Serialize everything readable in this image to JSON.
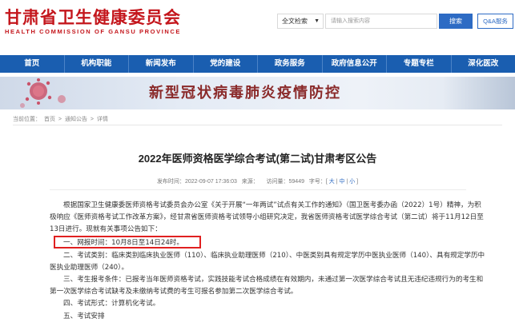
{
  "header": {
    "logo_cn": "甘肃省卫生健康委员会",
    "logo_en": "HEALTH COMMISSION OF GANSU PROVINCE",
    "search_scope": "全文检索",
    "search_placeholder": "请输入搜索内容",
    "search_button": "搜索",
    "qa_button": "Q&A服务"
  },
  "nav": {
    "items": [
      "首页",
      "机构职能",
      "新闻发布",
      "党的建设",
      "政务服务",
      "政府信息公开",
      "专题专栏",
      "深化医改"
    ]
  },
  "banner": {
    "text": "新型冠状病毒肺炎疫情防控"
  },
  "breadcrumb": {
    "prefix": "当前位置：",
    "items": [
      "首页",
      "通知公告",
      "详情"
    ],
    "separator": ">"
  },
  "article": {
    "title": "2022年医师资格医学综合考试(第二试)甘肃考区公告",
    "publish_label": "发布时间：",
    "publish_time": "2022-09-07 17:36:03",
    "source_label": "来源：",
    "visits_label": "访问量：",
    "visits": "59449",
    "font_label": "字号：",
    "font_large": "大",
    "font_medium": "中",
    "font_small": "小",
    "p1": "根据国家卫生健康委医师资格考试委员会办公室《关于开展“一年两试”试点有关工作的通知》（国卫医考委办函（2022）1号）精神，为积极响应《医师资格考试工作改革方案》，经甘肃省医师资格考试领导小组研究决定，我省医师资格考试医学综合考试（第二试）将于11月12日至13日进行。现就有关事项公告如下：",
    "item1": "一、网报时间：10月8日至14日24时。",
    "p2": "二、考试类别：临床类别临床执业医师（110）、临床执业助理医师（210）、中医类别具有规定学历中医执业医师（140）、具有规定学历中医执业助理医师（240）。",
    "p3": "三、考生报考条件：已报考当年医师资格考试，实践技能考试合格成绩在有效期内，未通过第一次医学综合考试且无违纪违规行为的考生和第一次医学综合考试缺考及未缴纳考试费的考生可报名参加第二次医学综合考试。",
    "item4": "四、考试形式：计算机化考试。",
    "item5": "五、考试安排"
  },
  "colors": {
    "brand_red": "#c4161c",
    "nav_blue": "#1a5eb0",
    "accent_blue": "#2d6bc4",
    "highlight_red": "#e02020"
  }
}
